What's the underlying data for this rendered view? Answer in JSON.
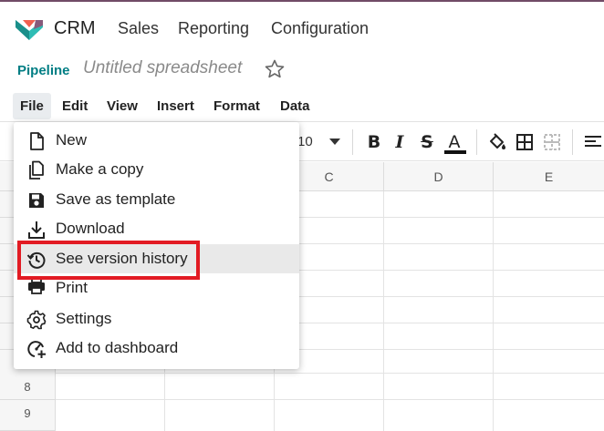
{
  "colors": {
    "brand_bar": "#714b67",
    "link": "#017e84",
    "highlight_border": "#e21b23",
    "menu_hover": "#e9e9e9"
  },
  "topnav": {
    "app_name": "CRM",
    "items": [
      "Sales",
      "Reporting",
      "Configuration"
    ]
  },
  "breadcrumb": {
    "parent": "Pipeline",
    "title": "Untitled spreadsheet",
    "star_icon": "star-outline-icon"
  },
  "menubar": {
    "items": [
      "File",
      "Edit",
      "View",
      "Insert",
      "Format",
      "Data"
    ]
  },
  "toolbar": {
    "font_size": "10",
    "bold": "B",
    "italic": "I",
    "strike": "S",
    "text_color": "A"
  },
  "grid": {
    "columns": [
      "C",
      "D",
      "E"
    ],
    "rows": [
      "8",
      "9"
    ]
  },
  "file_menu": {
    "items": [
      {
        "label": "New",
        "icon": "new-document-icon"
      },
      {
        "label": "Make a copy",
        "icon": "copy-icon"
      },
      {
        "label": "Save as template",
        "icon": "save-icon"
      },
      {
        "label": "Download",
        "icon": "download-icon"
      },
      {
        "label": "See version history",
        "icon": "history-icon"
      },
      {
        "label": "Print",
        "icon": "print-icon"
      },
      {
        "label": "Settings",
        "icon": "gear-icon"
      },
      {
        "label": "Add to dashboard",
        "icon": "add-dashboard-icon"
      }
    ],
    "hovered_item": "See version history"
  }
}
